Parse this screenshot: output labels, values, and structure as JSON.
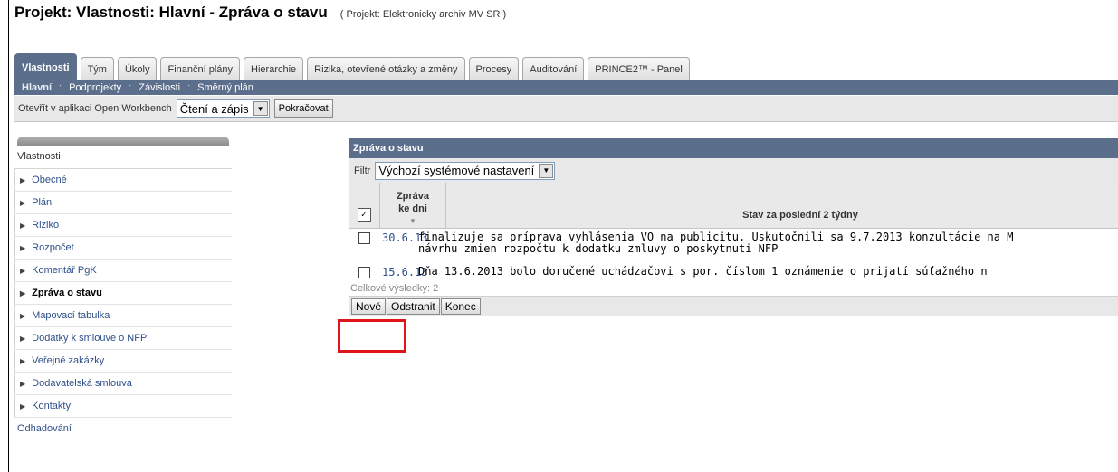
{
  "header": {
    "title": "Projekt: Vlastnosti: Hlavní - Zpráva o stavu",
    "subtitle": "( Projekt: Elektronicky archiv MV SR )"
  },
  "tabs": [
    {
      "label": "Vlastnosti",
      "active": true
    },
    {
      "label": "Tým"
    },
    {
      "label": "Úkoly"
    },
    {
      "label": "Finanční plány"
    },
    {
      "label": "Hierarchie"
    },
    {
      "label": "Rizika, otevřené otázky a změny"
    },
    {
      "label": "Procesy"
    },
    {
      "label": "Auditování"
    },
    {
      "label": "PRINCE2™ - Panel"
    }
  ],
  "subnav": [
    "Hlavní",
    "Podprojekty",
    "Závislosti",
    "Směrný plán"
  ],
  "toolbar": {
    "open_label": "Otevřít v aplikaci Open Workbench",
    "mode_value": "Čtení a zápis",
    "continue_label": "Pokračovat"
  },
  "sidebar": {
    "heading": "Vlastnosti",
    "items": [
      "Obecné",
      "Plán",
      "Riziko",
      "Rozpočet",
      "Komentář PgK",
      "Zpráva o stavu",
      "Mapovací tabulka",
      "Dodatky k smlouve o NFP",
      "Veřejné zakázky",
      "Dodavatelská smlouva",
      "Kontakty"
    ],
    "footer": "Odhadování"
  },
  "panel": {
    "title": "Zpráva o stavu",
    "filter_label": "Filtr",
    "filter_value": "Výchozí systémové nastavení",
    "col_date_1": "Zpráva",
    "col_date_2": "ke dni",
    "col_status": "Stav za poslední 2 týdny",
    "rows": [
      {
        "date": "30.6.13",
        "line1": "finalizuje sa príprava vyhlásenia VO na publicitu. Uskutočnili sa 9.7.2013 konzultácie na M",
        "line2": "návrhu zmien rozpočtu k dodatku zmluvy o poskytnuti NFP"
      },
      {
        "date": "15.6.13",
        "line1": "Dňa 13.6.2013 bolo doručené uchádzačovi s por. číslom 1 oznámenie o prijatí súťažného n"
      }
    ],
    "total": "Celkové výsledky: 2",
    "actions": {
      "new": "Nové",
      "delete": "Odstranit",
      "close": "Konec"
    }
  }
}
